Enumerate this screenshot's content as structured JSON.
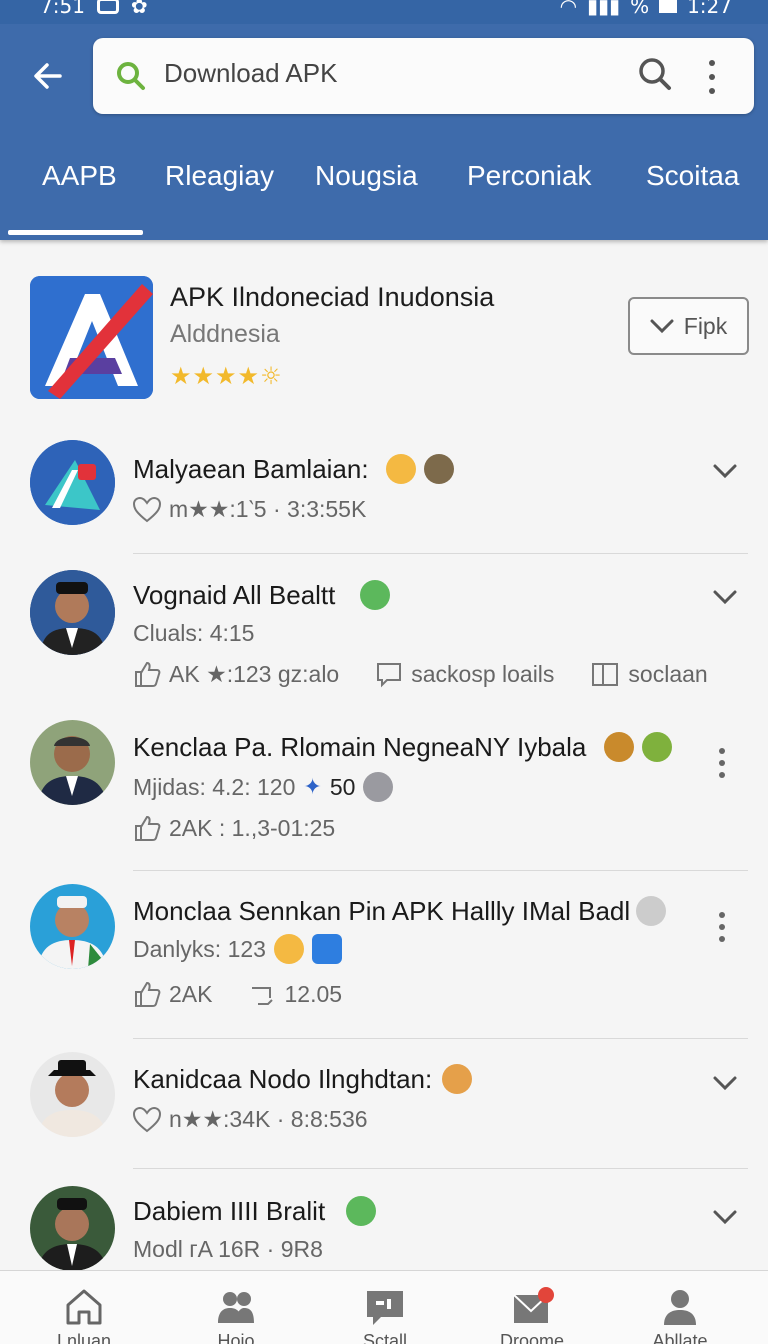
{
  "status_bar": {
    "time_left": "7:51",
    "battery": "%",
    "time_right": "1:27"
  },
  "search": {
    "query": "Download APK"
  },
  "tabs": [
    {
      "label": "AAPB",
      "active": true
    },
    {
      "label": "Rleagiay"
    },
    {
      "label": "Nougsia"
    },
    {
      "label": "Perconiak"
    },
    {
      "label": "Scoitaa"
    }
  ],
  "featured": {
    "title": "APK Ilndoneciad Inudonsia",
    "subtitle": "Alddnesia",
    "stars": "★★★★☼",
    "action_label": "Fipk"
  },
  "feed": [
    {
      "title": "Malyaean Bamlaian:",
      "meta": "m★★:1‵5 · 3:3:55K",
      "control": "chevron"
    },
    {
      "title": "Vognaid All Bealtt",
      "line2": "Cluals: 4:15",
      "likes": "AK ★:123 gz:alo",
      "comments": "sackosp loails",
      "share": "soclaan",
      "control": "chevron"
    },
    {
      "title": "Kenclaa Pa. Rlomain NegneaNY Iybala",
      "line2": "Mjidas: 4.2: 120",
      "badge": "50",
      "likes": "2AK : 1.,3-01:25",
      "control": "kebab"
    },
    {
      "title": "Monclaa Sennkan Pin APK Hallly IMal Badl",
      "line2": "Danlyks: 123",
      "likes": "2AK",
      "reposts": "12.05",
      "control": "kebab"
    },
    {
      "title": "Kanidcaa Nodo Ilnghdtan:",
      "meta": "n★★:34K · 8:8:536",
      "control": "chevron"
    },
    {
      "title": "Dabiem IIII Bralit",
      "line2": "Modl гA 16R · 9R8",
      "control": "chevron"
    }
  ],
  "bottom_nav": [
    {
      "label": "Lnluan"
    },
    {
      "label": "Hoio"
    },
    {
      "label": "Sctall"
    },
    {
      "label": "Droome"
    },
    {
      "label": "Abllate"
    }
  ],
  "colors": {
    "header_bg": "#3e6bab",
    "accent_green": "#5cb85c",
    "star": "#f2b92b"
  }
}
